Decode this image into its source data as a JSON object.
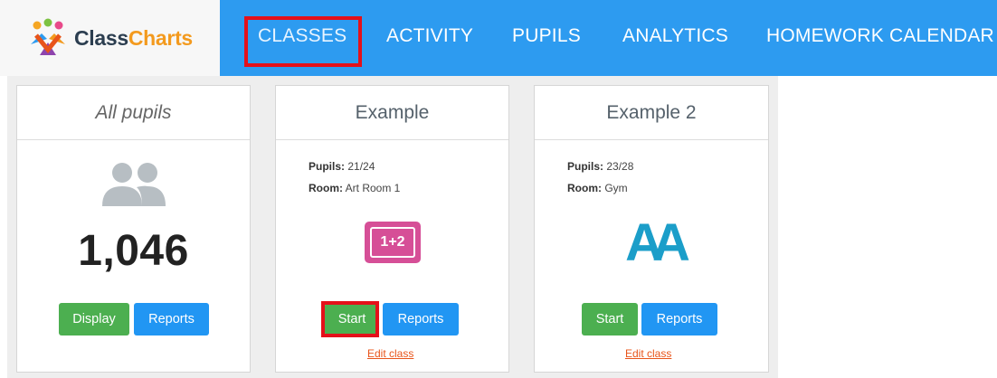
{
  "brand": {
    "name_part1": "Class",
    "name_part2": "Charts"
  },
  "nav": {
    "items": [
      {
        "label": "CLASSES",
        "active": true
      },
      {
        "label": "ACTIVITY"
      },
      {
        "label": "PUPILS"
      },
      {
        "label": "ANALYTICS"
      },
      {
        "label": "HOMEWORK CALENDAR"
      }
    ]
  },
  "cards": [
    {
      "title": "All pupils",
      "count": "1,046",
      "buttons": [
        "Display",
        "Reports"
      ]
    },
    {
      "title": "Example",
      "pupils_label": "Pupils:",
      "pupils_value": "21/24",
      "room_label": "Room:",
      "room_value": "Art Room 1",
      "icon_text": "1+2",
      "buttons": [
        "Start",
        "Reports"
      ],
      "edit": "Edit class"
    },
    {
      "title": "Example 2",
      "pupils_label": "Pupils:",
      "pupils_value": "23/28",
      "room_label": "Room:",
      "room_value": "Gym",
      "icon_text": "AA",
      "buttons": [
        "Start",
        "Reports"
      ],
      "edit": "Edit class"
    }
  ],
  "colors": {
    "nav_bg": "#2d9bf0",
    "highlight": "#e4101a",
    "green": "#4caf50",
    "blue": "#2196f3",
    "accent_orange": "#f39a1e"
  }
}
